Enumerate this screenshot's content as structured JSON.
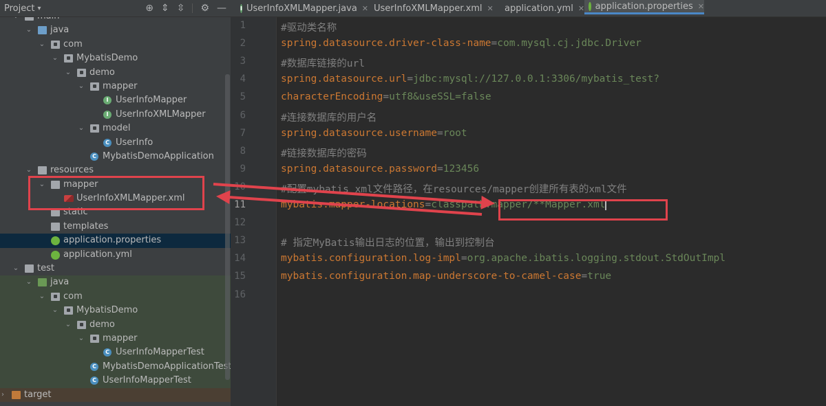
{
  "project_panel": {
    "title": "Project",
    "tree": [
      {
        "label": "main",
        "depth": 2,
        "icon": "folder",
        "color": "plain",
        "expanded": true
      },
      {
        "label": "java",
        "depth": 3,
        "icon": "folder",
        "color": "blue",
        "expanded": true
      },
      {
        "label": "com",
        "depth": 4,
        "icon": "package",
        "expanded": true
      },
      {
        "label": "MybatisDemo",
        "depth": 5,
        "icon": "package",
        "expanded": true
      },
      {
        "label": "demo",
        "depth": 6,
        "icon": "package",
        "expanded": true
      },
      {
        "label": "mapper",
        "depth": 7,
        "icon": "package",
        "expanded": true
      },
      {
        "label": "UserInfoMapper",
        "depth": 8,
        "icon": "interface"
      },
      {
        "label": "UserInfoXMLMapper",
        "depth": 8,
        "icon": "interface"
      },
      {
        "label": "model",
        "depth": 7,
        "icon": "package",
        "expanded": true
      },
      {
        "label": "UserInfo",
        "depth": 8,
        "icon": "class"
      },
      {
        "label": "MybatisDemoApplication",
        "depth": 7,
        "icon": "spring-class"
      },
      {
        "label": "resources",
        "depth": 3,
        "icon": "folder",
        "color": "plain",
        "expanded": true
      },
      {
        "label": "mapper",
        "depth": 4,
        "icon": "folder",
        "color": "plain",
        "expanded": true
      },
      {
        "label": "UserInfoXMLMapper.xml",
        "depth": 5,
        "icon": "xml"
      },
      {
        "label": "static",
        "depth": 4,
        "icon": "folder",
        "color": "plain"
      },
      {
        "label": "templates",
        "depth": 4,
        "icon": "folder",
        "color": "plain"
      },
      {
        "label": "application.properties",
        "depth": 4,
        "icon": "spring",
        "selected": true
      },
      {
        "label": "application.yml",
        "depth": 4,
        "icon": "spring"
      },
      {
        "label": "test",
        "depth": 2,
        "icon": "folder",
        "color": "plain",
        "expanded": true
      },
      {
        "label": "java",
        "depth": 3,
        "icon": "folder",
        "color": "green",
        "expanded": true,
        "test": true
      },
      {
        "label": "com",
        "depth": 4,
        "icon": "package",
        "expanded": true,
        "test": true
      },
      {
        "label": "MybatisDemo",
        "depth": 5,
        "icon": "package",
        "expanded": true,
        "test": true
      },
      {
        "label": "demo",
        "depth": 6,
        "icon": "package",
        "expanded": true,
        "test": true
      },
      {
        "label": "mapper",
        "depth": 7,
        "icon": "package",
        "expanded": true,
        "test": true
      },
      {
        "label": "UserInfoMapperTest",
        "depth": 8,
        "icon": "class",
        "test": true
      },
      {
        "label": "MybatisDemoApplicationTest",
        "depth": 7,
        "icon": "class",
        "test": true
      },
      {
        "label": "UserInfoMapperTest",
        "depth": 7,
        "icon": "class",
        "test": true
      },
      {
        "label": "target",
        "depth": 1,
        "icon": "folder",
        "color": "orange",
        "expanded": false,
        "excluded": true
      }
    ]
  },
  "tabs": [
    {
      "label": "UserInfoXMLMapper.java",
      "icon": "interface",
      "active": false
    },
    {
      "label": "UserInfoXMLMapper.xml",
      "icon": "xml",
      "active": false
    },
    {
      "label": "application.yml",
      "icon": "spring",
      "active": false
    },
    {
      "label": "application.properties",
      "icon": "spring",
      "active": true
    }
  ],
  "editor": {
    "current_line": 11,
    "lines": [
      {
        "n": "1",
        "parts": [
          [
            "c",
            "#驱动类名称"
          ]
        ]
      },
      {
        "n": "2",
        "parts": [
          [
            "k",
            "spring.datasource.driver-class-name"
          ],
          [
            "eq",
            "="
          ],
          [
            "v",
            "com.mysql.cj.jdbc.Driver"
          ]
        ]
      },
      {
        "n": "3",
        "parts": [
          [
            "c",
            "#数据库链接的url"
          ]
        ]
      },
      {
        "n": "4",
        "parts": [
          [
            "k",
            "spring.datasource.url"
          ],
          [
            "eq",
            "="
          ],
          [
            "v",
            "jdbc:mysql://127.0.0.1:3306/mybatis_test?"
          ]
        ]
      },
      {
        "n": "5",
        "parts": [
          [
            "k",
            "characterEncoding"
          ],
          [
            "eq",
            "="
          ],
          [
            "v",
            "utf8&useSSL=false"
          ]
        ]
      },
      {
        "n": "6",
        "parts": [
          [
            "c",
            "#连接数据库的用户名"
          ]
        ]
      },
      {
        "n": "7",
        "parts": [
          [
            "k",
            "spring.datasource.username"
          ],
          [
            "eq",
            "="
          ],
          [
            "v",
            "root"
          ]
        ]
      },
      {
        "n": "8",
        "parts": [
          [
            "c",
            "#链接数据库的密码"
          ]
        ]
      },
      {
        "n": "9",
        "parts": [
          [
            "k",
            "spring.datasource.password"
          ],
          [
            "eq",
            "="
          ],
          [
            "v",
            "123456"
          ]
        ]
      },
      {
        "n": "10",
        "parts": [
          [
            "c",
            "#配置mybatis xml文件路径，在resources/mapper创建所有表的xml文件"
          ]
        ]
      },
      {
        "n": "11",
        "parts": [
          [
            "k",
            "mybatis.mapper-locations"
          ],
          [
            "eq",
            "="
          ],
          [
            "v",
            "classpath:mapper/**Mapper.xml"
          ]
        ]
      },
      {
        "n": "12",
        "parts": []
      },
      {
        "n": "13",
        "parts": [
          [
            "c",
            "# 指定MyBatis输出日志的位置，输出到控制台"
          ]
        ]
      },
      {
        "n": "14",
        "parts": [
          [
            "k",
            "mybatis.configuration.log-impl"
          ],
          [
            "eq",
            "="
          ],
          [
            "v",
            "org.apache.ibatis.logging.stdout.StdOutImpl"
          ]
        ]
      },
      {
        "n": "15",
        "parts": [
          [
            "k",
            "mybatis.configuration.map-underscore-to-camel-case"
          ],
          [
            "eq",
            "="
          ],
          [
            "v",
            "true"
          ]
        ]
      },
      {
        "n": "16",
        "parts": []
      }
    ]
  },
  "colors": {
    "keyword": "#cc7832",
    "value": "#6a8759",
    "comment": "#808080",
    "annotation": "#e0434c",
    "selection": "#0d293e"
  }
}
